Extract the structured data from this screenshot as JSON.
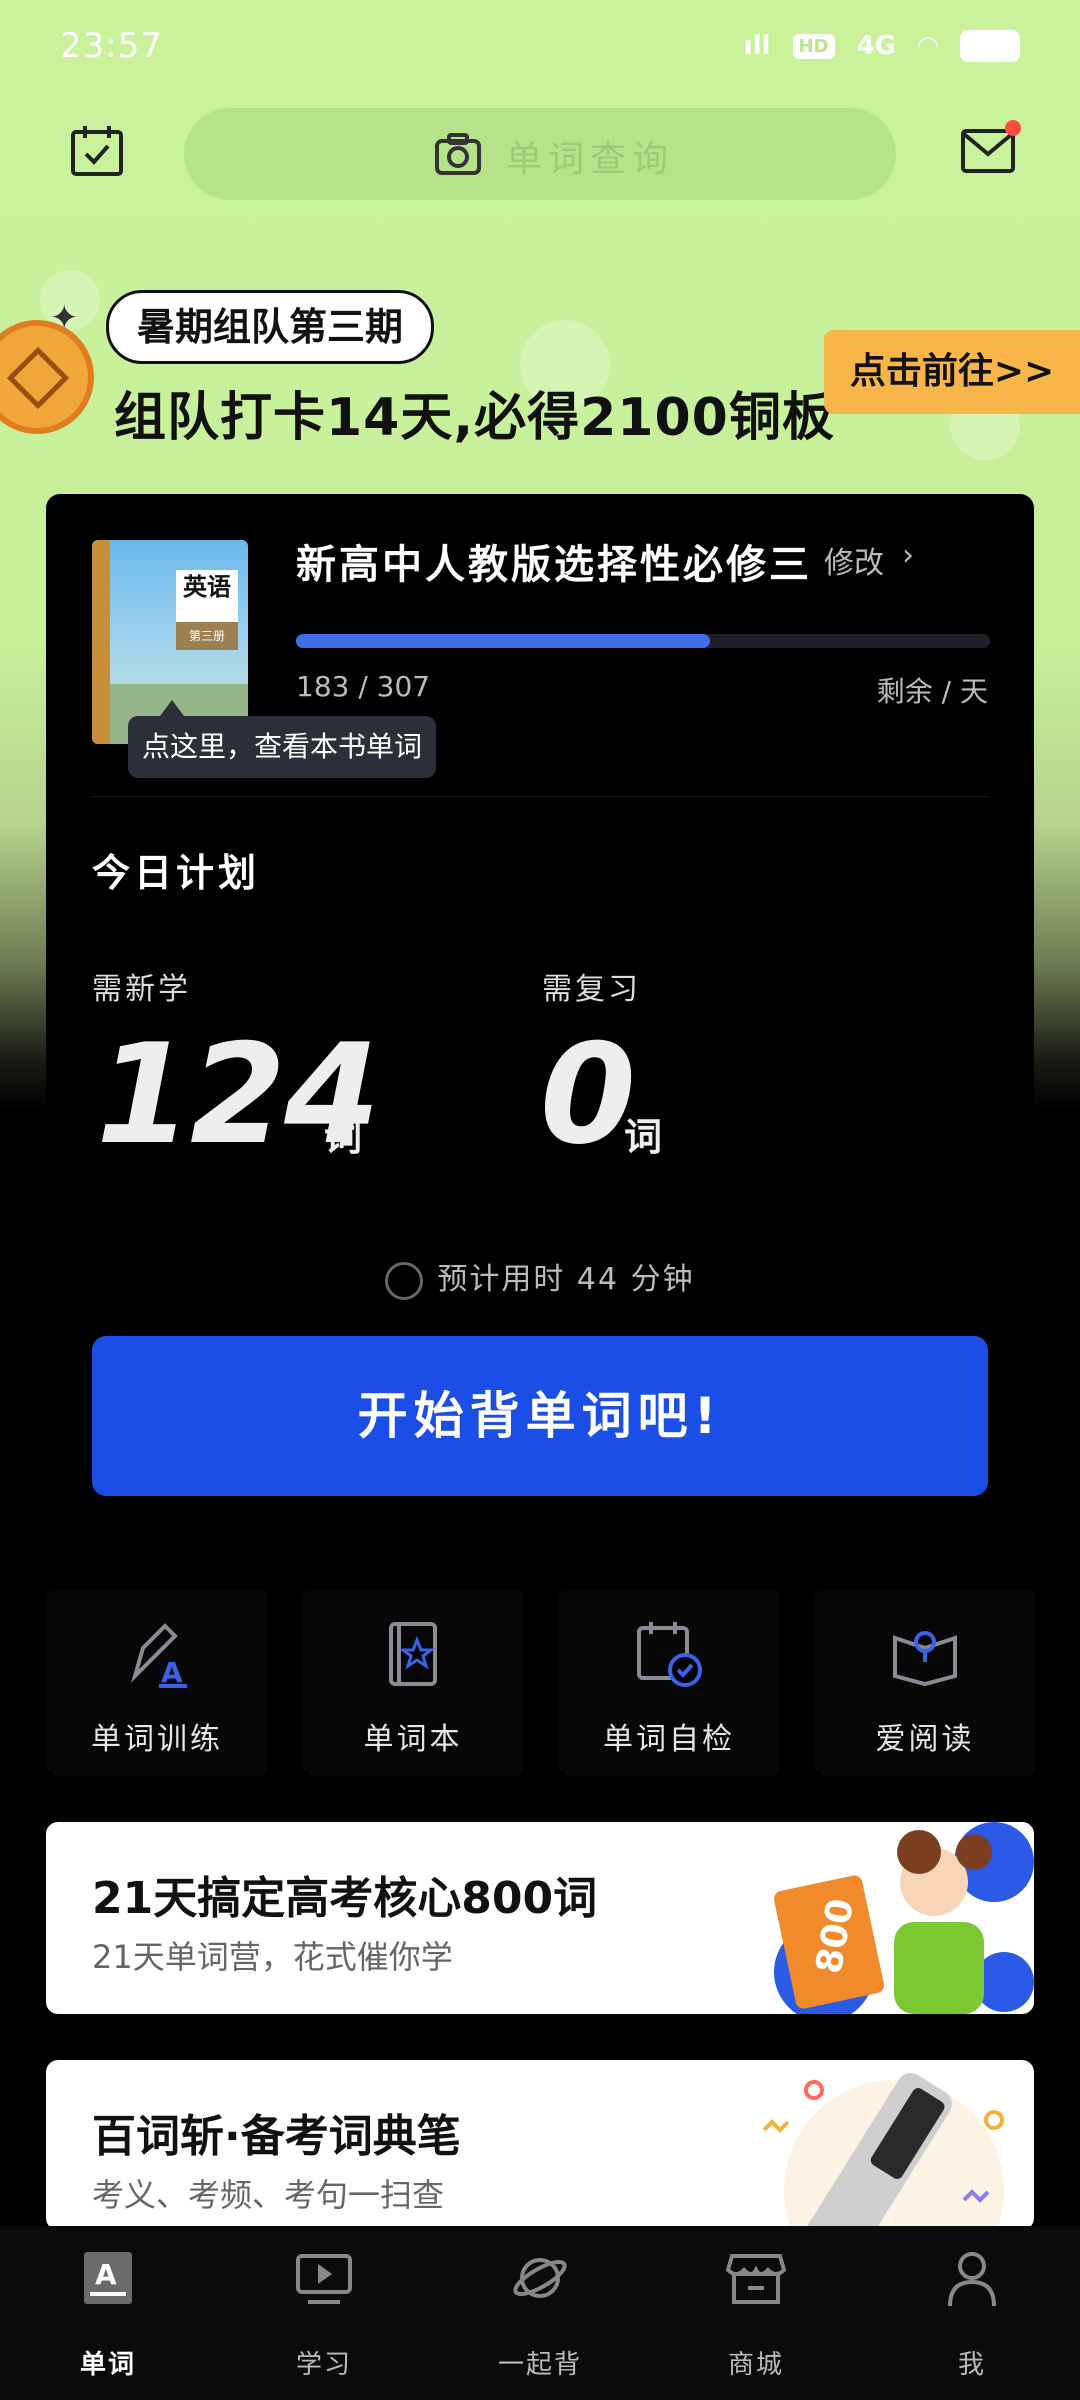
{
  "status_bar": {
    "time": "23:57",
    "hd": "HD",
    "network": "4G"
  },
  "top_bar": {
    "search_placeholder": "单词查询"
  },
  "promo": {
    "tag": "暑期组队第三期",
    "headline": "组队打卡14天,必得2100铜板",
    "cta": "点击前往>>"
  },
  "book": {
    "cover_title": "英语",
    "cover_volume": "第三册",
    "name": "新高中人教版选择性必修三",
    "modify": "修改",
    "learned": 183,
    "total": 307,
    "progress_text": "183 / 307",
    "remaining": "剩余 / 天",
    "tooltip": "点这里，查看本书单词"
  },
  "plan": {
    "title": "今日计划",
    "new_label": "需新学",
    "new_count": "124",
    "review_label": "需复习",
    "review_count": "0",
    "unit": "词",
    "eta": "预计用时 44 分钟",
    "start_button": "开始背单词吧!"
  },
  "tools": [
    {
      "label": "单词训练",
      "icon": "pen-icon"
    },
    {
      "label": "单词本",
      "icon": "star-book-icon"
    },
    {
      "label": "单词自检",
      "icon": "calendar-check-icon"
    },
    {
      "label": "爱阅读",
      "icon": "open-book-icon"
    }
  ],
  "cards": [
    {
      "title": "21天搞定高考核心800词",
      "subtitle": "21天单词营，花式催你学",
      "badge": "800"
    },
    {
      "title": "百词斩·备考词典笔",
      "subtitle": "考义、考频、考句一扫查"
    }
  ],
  "nav": [
    {
      "label": "单词",
      "icon": "word-a-icon",
      "active": true
    },
    {
      "label": "学习",
      "icon": "play-screen-icon"
    },
    {
      "label": "一起背",
      "icon": "planet-icon"
    },
    {
      "label": "商城",
      "icon": "store-icon"
    },
    {
      "label": "我",
      "icon": "person-icon"
    }
  ],
  "colors": {
    "accent": "#1a4ee6",
    "background_top": "#c9f29b",
    "progress": "#3f6fe8"
  }
}
